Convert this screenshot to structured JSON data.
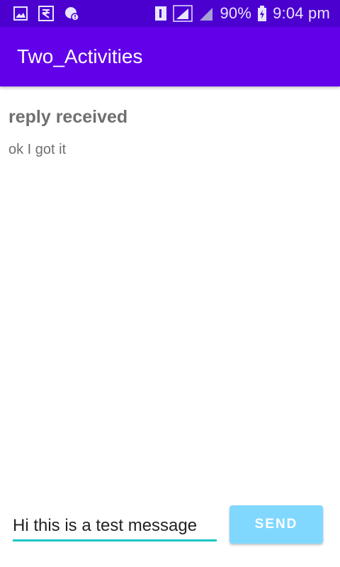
{
  "status_bar": {
    "battery_percent": "90%",
    "time": "9:04 pm",
    "icons": [
      "gallery-icon",
      "rupee-icon",
      "shield-alert-icon",
      "sim1-icon",
      "signal-icon",
      "signal-secondary-icon",
      "battery-charging-icon"
    ],
    "colors": {
      "background": "#4b00d0",
      "text": "#e9e6ff"
    }
  },
  "app_bar": {
    "title": "Two_Activities",
    "background": "#6200ea"
  },
  "content": {
    "reply_header": "reply received",
    "reply_text": "ok I got it"
  },
  "composer": {
    "input_value": "Hi this is a test message",
    "send_label": "SEND",
    "send_color": "#80d8ff",
    "underline_color": "#1cc6c6"
  }
}
